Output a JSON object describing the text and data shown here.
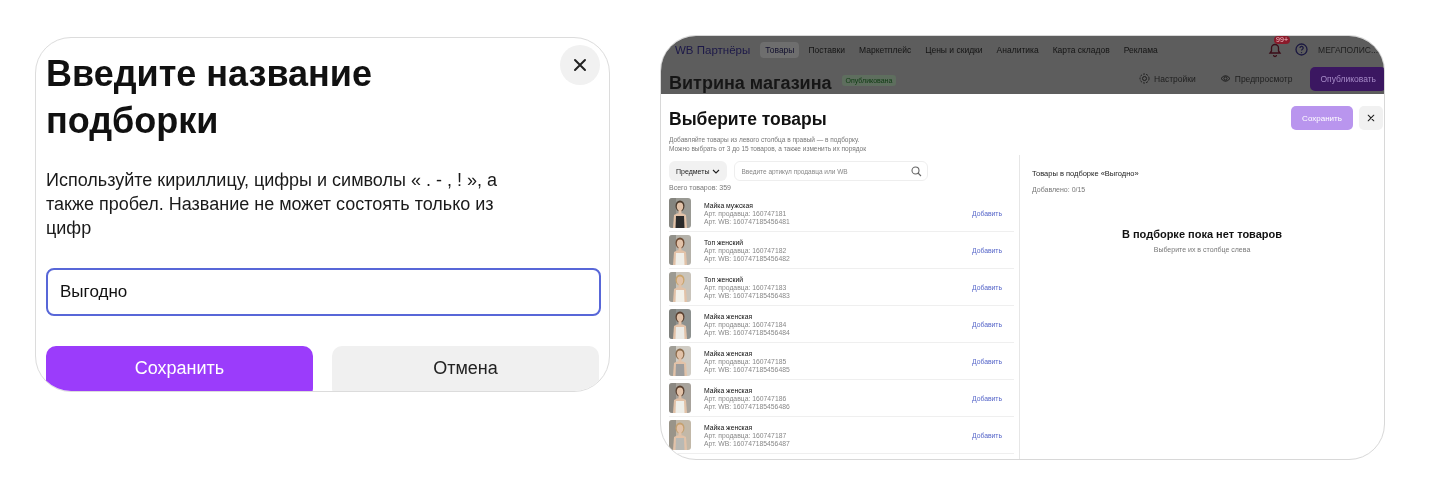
{
  "name_dialog": {
    "title": "Введите название подборки",
    "description": "Используйте кириллицу, цифры и символы « . - , ! », а также пробел. Название не может состоять только из цифр",
    "input_value": "Выгодно",
    "buttons": [
      {
        "label": "Сохранить",
        "kind": "primary"
      },
      {
        "label": "Отмена",
        "kind": "secondary"
      }
    ]
  },
  "screen": {
    "nav": {
      "logo": "WB Партнёры",
      "items": [
        {
          "label": "Товары",
          "selected": true
        },
        {
          "label": "Поставки",
          "selected": false
        },
        {
          "label": "Маркетплейс",
          "selected": false
        },
        {
          "label": "Цены и скидки",
          "selected": false
        },
        {
          "label": "Аналитика",
          "selected": false
        },
        {
          "label": "Карта складов",
          "selected": false
        },
        {
          "label": "Реклама",
          "selected": false
        }
      ],
      "notification_badge": "99+",
      "account": "МЕГАПОЛИС..."
    },
    "page_title": "Витрина магазина",
    "status_badge": "Опубликована",
    "actions": [
      {
        "label": "Настройки",
        "kind": "settings"
      },
      {
        "label": "Предпросмотр",
        "kind": "preview"
      },
      {
        "label": "Опубликовать",
        "kind": "primary"
      }
    ],
    "modal": {
      "title": "Выберите товары",
      "description": "Добавляйте товары из левого столбца в правый — в подборку.\nМожно выбрать от 3 до 15 товаров, а также изменить их порядок",
      "save_button": {
        "label": "Сохранить",
        "disabled": true
      },
      "filter": "Предметы",
      "search_placeholder": "Введите артикул продавца или WB",
      "total": "Всего товаров: 359",
      "products": [
        {
          "name": "Майка мужская",
          "seller_article": "Арт. продавца: 160747181",
          "wb_article": "Арт. WB: 160747185456481",
          "action": "Добавить"
        },
        {
          "name": "Топ женский",
          "seller_article": "Арт. продавца: 160747182",
          "wb_article": "Арт. WB: 160747185456482",
          "action": "Добавить"
        },
        {
          "name": "Топ женский",
          "seller_article": "Арт. продавца: 160747183",
          "wb_article": "Арт. WB: 160747185456483",
          "action": "Добавить"
        },
        {
          "name": "Майка женская",
          "seller_article": "Арт. продавца: 160747184",
          "wb_article": "Арт. WB: 160747185456484",
          "action": "Добавить"
        },
        {
          "name": "Майка женская",
          "seller_article": "Арт. продавца: 160747185",
          "wb_article": "Арт. WB: 160747185456485",
          "action": "Добавить"
        },
        {
          "name": "Майка женская",
          "seller_article": "Арт. продавца: 160747186",
          "wb_article": "Арт. WB: 160747185456486",
          "action": "Добавить"
        },
        {
          "name": "Майка женская",
          "seller_article": "Арт. продавца: 160747187",
          "wb_article": "Арт. WB: 160747185456487",
          "action": "Добавить"
        }
      ],
      "selection_title": "Товары в подборке «Выгодно»",
      "added_count": "Добавлено: 0/15",
      "empty_title": "В подборке пока нет товаров",
      "empty_hint": "Выберите их в столбце слева"
    }
  }
}
